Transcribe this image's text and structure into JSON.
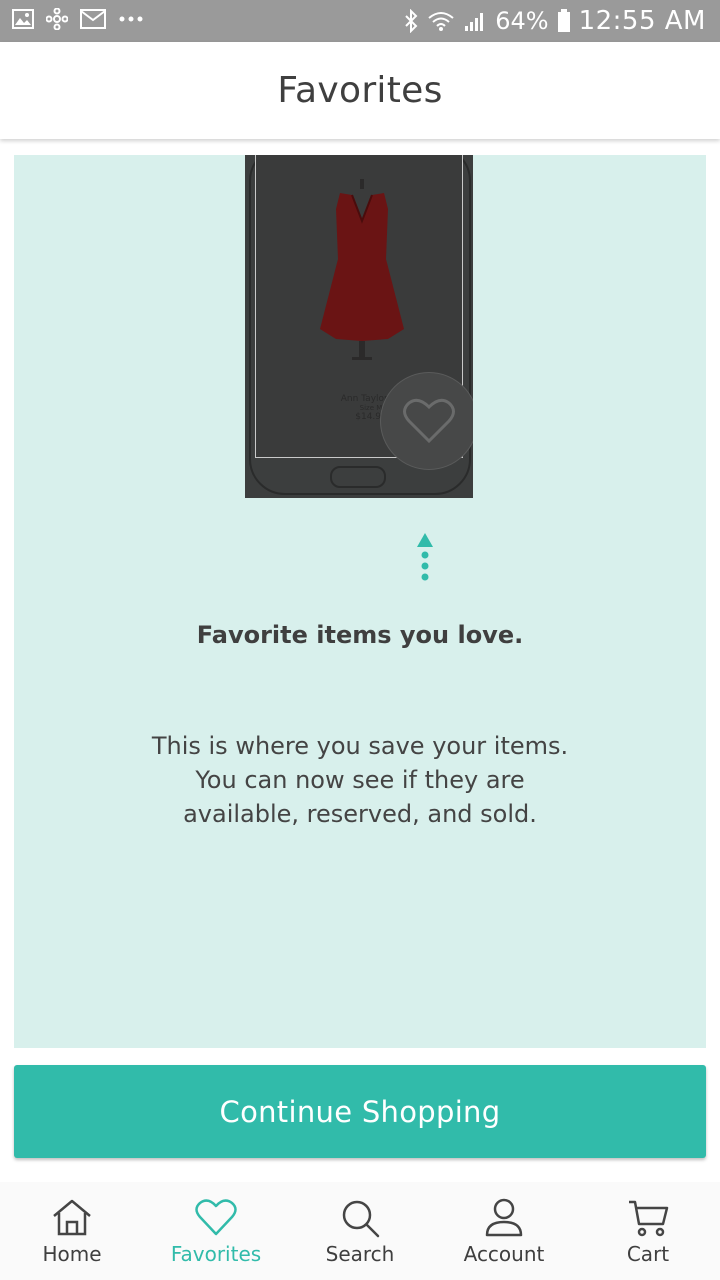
{
  "status_bar": {
    "battery": "64%",
    "time": "12:55 AM",
    "left_icons": [
      "image-icon",
      "pinwheel-icon",
      "gmail-icon",
      "more-dots-icon"
    ],
    "right_icons": [
      "bluetooth-icon",
      "wifi-icon",
      "signal-icon",
      "battery-icon"
    ]
  },
  "header": {
    "title": "Favorites"
  },
  "onboarding": {
    "illustration": {
      "product_name": "Ann Taylor Dr",
      "product_size": "Size M",
      "product_price": "$14.99"
    },
    "heading": "Favorite items you love.",
    "body_line1": "This is where you save your items.",
    "body_line2": "You can now see if they are",
    "body_line3": "available, reserved, and sold."
  },
  "cta": {
    "label": "Continue Shopping"
  },
  "bottom_nav": {
    "active": "Favorites",
    "items": [
      {
        "label": "Home",
        "icon": "home-icon"
      },
      {
        "label": "Favorites",
        "icon": "heart-icon"
      },
      {
        "label": "Search",
        "icon": "search-icon"
      },
      {
        "label": "Account",
        "icon": "account-icon"
      },
      {
        "label": "Cart",
        "icon": "cart-icon"
      }
    ]
  },
  "colors": {
    "accent": "#31bbaa",
    "panel_bg": "#d8f0ec",
    "status_bar": "#9a9a9a",
    "text": "#3f3f3f"
  }
}
